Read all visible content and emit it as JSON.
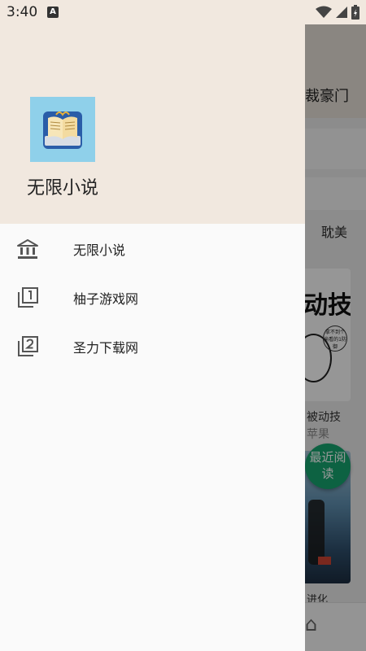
{
  "status_bar": {
    "time": "3:40",
    "notification_icon": "A"
  },
  "background_app": {
    "title": "裁豪门",
    "tag": "耽美",
    "book1": {
      "cover_text": "动技",
      "bubble_text": "拿不到个偷看的1防御",
      "name": "被动技",
      "author": "苹果"
    },
    "book2": {
      "name": "进化"
    },
    "recent_button": "最近阅读"
  },
  "drawer": {
    "app_name": "无限小说",
    "menu": [
      {
        "label": "无限小说",
        "icon": "bank-icon"
      },
      {
        "label": "柚子游戏网",
        "icon": "filter-1-icon"
      },
      {
        "label": "圣力下载网",
        "icon": "filter-2-icon"
      }
    ]
  }
}
